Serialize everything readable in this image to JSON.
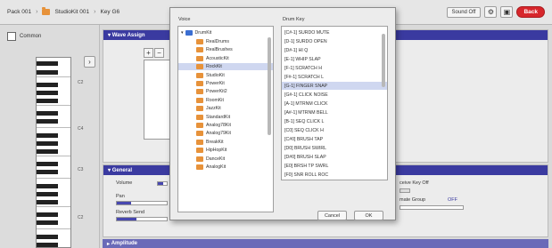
{
  "topbar": {
    "crumbs": [
      "Pack 001",
      "StudioKit 001",
      "Key G6"
    ],
    "sound_off": "Sound Off",
    "back": "Back"
  },
  "leftpane": {
    "common": "Common",
    "kb_labels": [
      "C2",
      "C4",
      "C3",
      "C2"
    ]
  },
  "wave": {
    "title": "Wave Assign",
    "plus": "+",
    "minus": "−"
  },
  "general": {
    "title": "General",
    "volume": "Volume",
    "pan": "Pan",
    "reverb": "Reverb Send",
    "receive_keyoff": "ceive Key Off",
    "mute_group": "mate Group",
    "mute_group_value": "OFF"
  },
  "amplitude": {
    "title": "Amplitude"
  },
  "dialog": {
    "voice_label": "Voice",
    "drumkey_label": "Drum Key",
    "tree_root": "DrumKit",
    "tree_items": [
      "RealDrums",
      "RealBrushes",
      "AcousticKit",
      "RockKit",
      "StudioKit",
      "PowerKit",
      "PowerKit2",
      "RoomKit",
      "JazzKit",
      "StandardKit",
      "Analog78Kit",
      "Analog79Kit",
      "BreakKit",
      "HipHopKit",
      "DanceKit",
      "AnalogKit"
    ],
    "selected_tree": "RockKit",
    "keys": [
      "[C#-1] SURDO MUTE",
      "[D-1] SURDO OPEN",
      "[D#-1] HI Q",
      "[E-1] WHIP SLAP",
      "[F-1] SCRATCH H",
      "[F#-1] SCRATCH L",
      "[G-1] FINGER SNAP",
      "[G#-1] CLICK NOISE",
      "[A-1] MTRNM CLICK",
      "[A#-1] MTRNM BELL",
      "[B-1] SEQ CLICK L",
      "[C0] SEQ CLICK H",
      "[C#0] BRUSH TAP",
      "[D0] BRUSH SWIRL",
      "[D#0] BRUSH SLAP",
      "[E0] BRSH TP SWRL",
      "[F0] SNR ROLL ROC"
    ],
    "selected_key": "[G-1] FINGER SNAP",
    "cancel": "Cancel",
    "ok": "OK"
  },
  "colors": {
    "header": "#3a3aa0",
    "back": "#d7262b",
    "selection": "#cfd7f0",
    "folder": "#e7923a"
  }
}
